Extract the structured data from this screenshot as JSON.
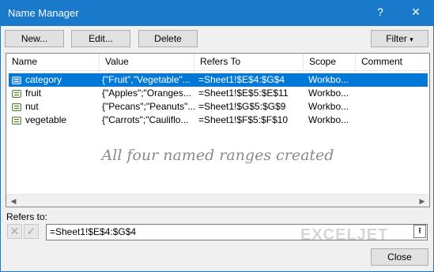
{
  "window": {
    "title": "Name Manager",
    "help": "?",
    "close": "✕"
  },
  "toolbar": {
    "new_label": "New...",
    "edit_label": "Edit...",
    "delete_label": "Delete",
    "filter_label": "Filter",
    "filter_arrow": "▾"
  },
  "table": {
    "columns": [
      "Name",
      "Value",
      "Refers To",
      "Scope",
      "Comment"
    ],
    "rows": [
      {
        "name": "category",
        "value": "{\"Fruit\",\"Vegetable\"...",
        "refers_to": "=Sheet1!$E$4:$G$4",
        "scope": "Workbo...",
        "comment": "",
        "selected": true
      },
      {
        "name": "fruit",
        "value": "{\"Apples\";\"Oranges...",
        "refers_to": "=Sheet1!$E$5:$E$11",
        "scope": "Workbo...",
        "comment": "",
        "selected": false
      },
      {
        "name": "nut",
        "value": "{\"Pecans\";\"Peanuts\"...",
        "refers_to": "=Sheet1!$G$5:$G$9",
        "scope": "Workbo...",
        "comment": "",
        "selected": false
      },
      {
        "name": "vegetable",
        "value": "{\"Carrots\";\"Cauliflo...",
        "refers_to": "=Sheet1!$F$5:$F$10",
        "scope": "Workbo...",
        "comment": "",
        "selected": false
      }
    ],
    "annotation": "All four named ranges created",
    "scroll_left": "◀",
    "scroll_right": "▶"
  },
  "refers": {
    "label": "Refers to:",
    "value": "=Sheet1!$E$4:$G$4",
    "cancel_glyph": "✕",
    "confirm_glyph": "✓",
    "collapse_glyph": "⭱"
  },
  "watermark": "EXCELJET",
  "footer": {
    "close_label": "Close"
  },
  "colors": {
    "titlebar": "#1979ca",
    "selection": "#0078d7"
  }
}
